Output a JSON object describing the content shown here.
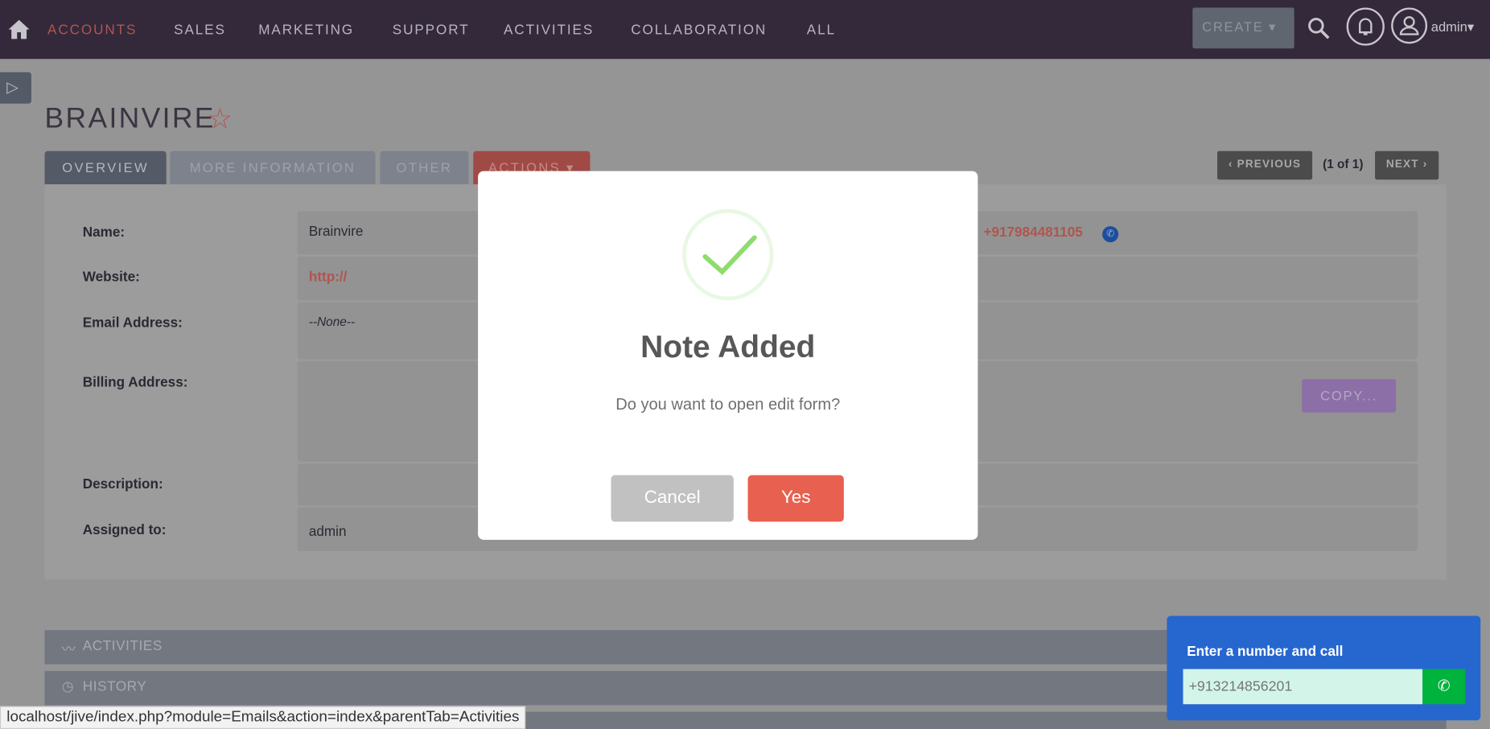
{
  "nav": {
    "items": [
      "ACCOUNTS",
      "SALES",
      "MARKETING",
      "SUPPORT",
      "ACTIVITIES",
      "COLLABORATION",
      "ALL"
    ],
    "create": "CREATE",
    "user": "admin"
  },
  "record": {
    "title": "BRAINVIRE",
    "tabs": [
      "OVERVIEW",
      "MORE INFORMATION",
      "OTHER",
      "ACTIONS"
    ],
    "pager": {
      "previous": "PREVIOUS",
      "count": "(1 of 1)",
      "next": "NEXT"
    },
    "fields": {
      "name_label": "Name:",
      "name": "Brainvire",
      "phone": "+917984481105",
      "website_label": "Website:",
      "website": "http://",
      "email_label": "Email Address:",
      "email": "--None--",
      "billing_label": "Billing Address:",
      "copy": "COPY...",
      "description_label": "Description:",
      "assigned_label": "Assigned to:",
      "assigned": "admin"
    }
  },
  "subpanels": [
    "ACTIVITIES",
    "HISTORY"
  ],
  "modal": {
    "title": "Note Added",
    "text": "Do you want to open edit form?",
    "cancel": "Cancel",
    "yes": "Yes"
  },
  "call_widget": {
    "title": "Enter a number and call",
    "placeholder": "+913214856201"
  },
  "status_bar": "localhost/jive/index.php?module=Emails&action=index&parentTab=Activities",
  "colors": {
    "accent": "#e8604f",
    "header": "#352a3c",
    "call_widget": "#2667cf",
    "call_button": "#00b33c"
  }
}
